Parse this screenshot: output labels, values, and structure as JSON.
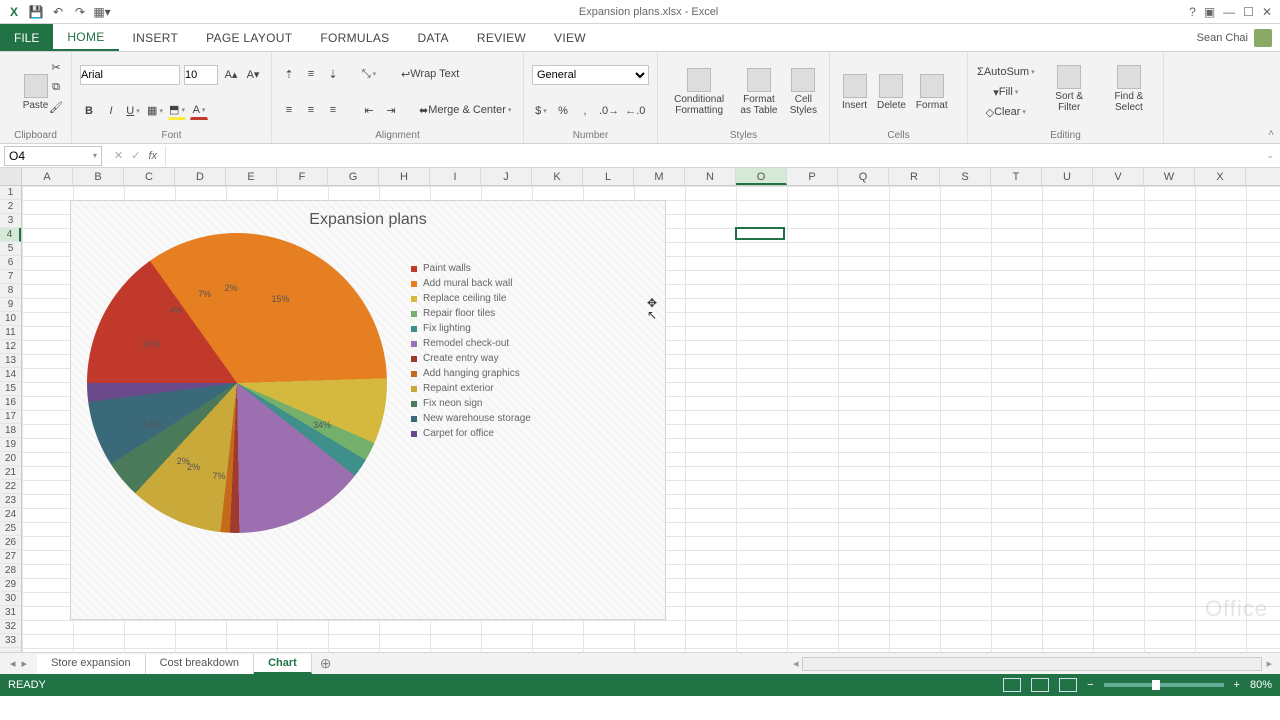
{
  "title_bar": {
    "document_title": "Expansion plans.xlsx - Excel"
  },
  "user": {
    "name": "Sean Chai"
  },
  "ribbon_tabs": {
    "file": "FILE",
    "items": [
      "HOME",
      "INSERT",
      "PAGE LAYOUT",
      "FORMULAS",
      "DATA",
      "REVIEW",
      "VIEW"
    ],
    "active": "HOME"
  },
  "ribbon": {
    "clipboard": {
      "paste": "Paste",
      "label": "Clipboard"
    },
    "font": {
      "name": "Arial",
      "size": "10",
      "label": "Font"
    },
    "alignment": {
      "wrap": "Wrap Text",
      "merge": "Merge & Center",
      "label": "Alignment"
    },
    "number": {
      "format": "General",
      "label": "Number"
    },
    "styles": {
      "cond": "Conditional Formatting",
      "fmt_table": "Format as Table",
      "cell_styles": "Cell Styles",
      "label": "Styles"
    },
    "cells": {
      "insert": "Insert",
      "delete": "Delete",
      "format": "Format",
      "label": "Cells"
    },
    "editing": {
      "autosum": "AutoSum",
      "fill": "Fill",
      "clear": "Clear",
      "sort": "Sort & Filter",
      "find": "Find & Select",
      "label": "Editing"
    }
  },
  "formula_bar": {
    "cell_ref": "O4",
    "fx": "fx",
    "value": ""
  },
  "columns": [
    "A",
    "B",
    "C",
    "D",
    "E",
    "F",
    "G",
    "H",
    "I",
    "J",
    "K",
    "L",
    "M",
    "N",
    "O",
    "P",
    "Q",
    "R",
    "S",
    "T",
    "U",
    "V",
    "W",
    "X"
  ],
  "selected_col_index": 14,
  "selected_row": 4,
  "row_count": 33,
  "sheet_tabs": {
    "items": [
      "Store expansion",
      "Cost breakdown",
      "Chart"
    ],
    "active": "Chart"
  },
  "status": {
    "ready": "READY",
    "zoom": "80%"
  },
  "watermark": "Office",
  "chart_data": {
    "type": "pie",
    "title": "Expansion plans",
    "series": [
      {
        "name": "Paint walls",
        "value": 15,
        "label": "15%",
        "color": "#c0392b"
      },
      {
        "name": "Add mural back wall",
        "value": 34,
        "label": "34%",
        "color": "#e67e22"
      },
      {
        "name": "Replace ceiling tile",
        "value": 7,
        "label": "7%",
        "color": "#d4b93e"
      },
      {
        "name": "Repair floor tiles",
        "value": 2,
        "label": "2%",
        "color": "#74b06b"
      },
      {
        "name": "Fix lighting",
        "value": 2,
        "label": "2%",
        "color": "#3f8f8a"
      },
      {
        "name": "Remodel check-out",
        "value": 14,
        "label": "14%",
        "color": "#9b6fb0"
      },
      {
        "name": "Create entry way",
        "value": 1,
        "label": "1%",
        "color": "#a03a2e"
      },
      {
        "name": "Add hanging graphics",
        "value": 1,
        "label": "1%",
        "color": "#c46a1a"
      },
      {
        "name": "Repaint exterior",
        "value": 10,
        "label": "10%",
        "color": "#c9a93a"
      },
      {
        "name": "Fix neon sign",
        "value": 4,
        "label": "4%",
        "color": "#4a7a5a"
      },
      {
        "name": "New warehouse storage",
        "value": 7,
        "label": "7%",
        "color": "#3a6a7a"
      },
      {
        "name": "Carpet for office",
        "value": 2,
        "label": "2%",
        "color": "#6a4a8a"
      }
    ]
  }
}
